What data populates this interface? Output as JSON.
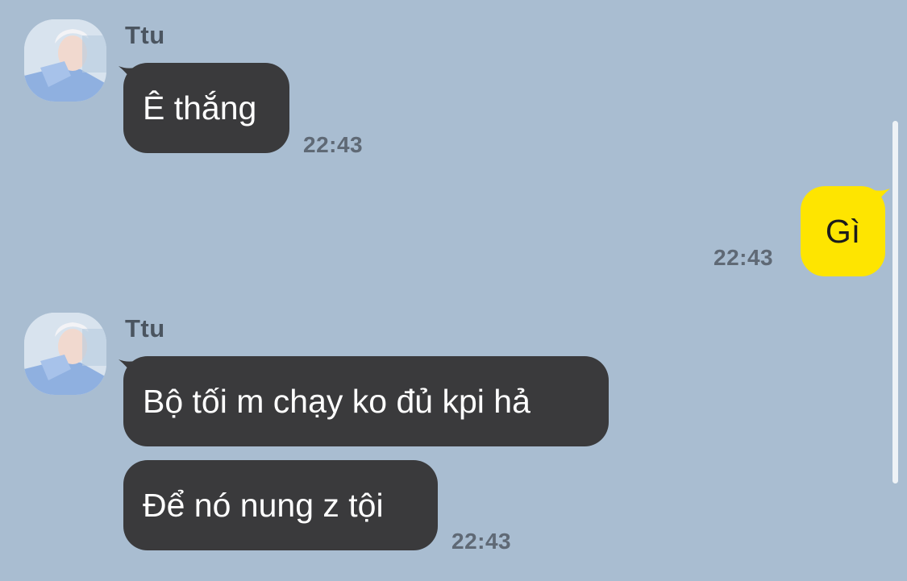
{
  "messages": [
    {
      "direction": "incoming",
      "sender": "Ttu",
      "avatar_icon": "profile-photo",
      "bubbles": [
        "Ê thắng"
      ],
      "time": "22:43"
    },
    {
      "direction": "outgoing",
      "bubbles": [
        "Gì"
      ],
      "time": "22:43"
    },
    {
      "direction": "incoming",
      "sender": "Ttu",
      "avatar_icon": "profile-photo",
      "bubbles": [
        "Bộ tối m chạy ko đủ kpi hả",
        "Để nó nung z tội"
      ],
      "time": "22:43"
    }
  ],
  "colors": {
    "background": "#a9bdd1",
    "incoming_bubble": "#3a3a3c",
    "outgoing_bubble": "#fee500",
    "time_text": "#5f6975"
  }
}
